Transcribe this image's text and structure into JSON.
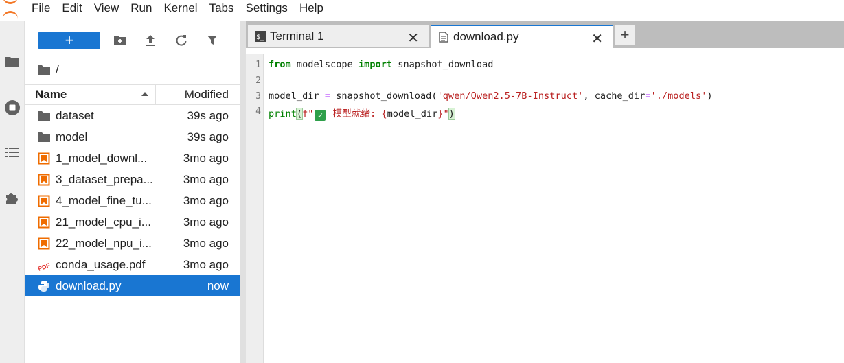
{
  "menubar": {
    "items": [
      "File",
      "Edit",
      "View",
      "Run",
      "Kernel",
      "Tabs",
      "Settings",
      "Help"
    ]
  },
  "toolbar": {
    "new_label": "+"
  },
  "breadcrumb": {
    "path": "/"
  },
  "filelist": {
    "header_name": "Name",
    "header_modified": "Modified",
    "rows": [
      {
        "name": "dataset",
        "modified": "39s ago",
        "icon": "folder-icon"
      },
      {
        "name": "model",
        "modified": "39s ago",
        "icon": "folder-icon"
      },
      {
        "name": "1_model_downl...",
        "modified": "3mo ago",
        "icon": "notebook-icon"
      },
      {
        "name": "3_dataset_prepa...",
        "modified": "3mo ago",
        "icon": "notebook-icon"
      },
      {
        "name": "4_model_fine_tu...",
        "modified": "3mo ago",
        "icon": "notebook-icon"
      },
      {
        "name": "21_model_cpu_i...",
        "modified": "3mo ago",
        "icon": "notebook-icon"
      },
      {
        "name": "22_model_npu_i...",
        "modified": "3mo ago",
        "icon": "notebook-icon"
      },
      {
        "name": "conda_usage.pdf",
        "modified": "3mo ago",
        "icon": "pdf-icon"
      },
      {
        "name": "download.py",
        "modified": "now",
        "icon": "python-icon",
        "selected": true
      }
    ]
  },
  "tabs": [
    {
      "label": "Terminal 1",
      "icon": "terminal-icon",
      "active": false
    },
    {
      "label": "download.py",
      "icon": "file-text-icon",
      "active": true
    }
  ],
  "editor": {
    "line_numbers": [
      "1",
      "2",
      "3",
      "4"
    ],
    "line1": {
      "kw1": "from",
      "mod": " modelscope ",
      "kw2": "import",
      "rest": " snapshot_download"
    },
    "line3": {
      "var": "model_dir ",
      "op": "=",
      "call": " snapshot_download(",
      "str1": "'qwen/Qwen2.5-7B-Instruct'",
      "mid": ", cache_dir",
      "op2": "=",
      "str2": "'./models'",
      "end": ")"
    },
    "line4": {
      "fn": "print",
      "open": "(",
      "fprefix": "f\"",
      "check": "✓",
      "text": " 模型就绪: ",
      "brace_open": "{",
      "var": "model_dir",
      "brace_close": "}",
      "fend": "\"",
      "close": ")"
    }
  },
  "colors": {
    "accent": "#1976d2",
    "jupyter_orange": "#f37726",
    "notebook_orange": "#ef6c00",
    "pdf_red": "#e53935",
    "keyword_green": "#008000",
    "string_red": "#ba2121",
    "operator_purple": "#aa22ff"
  }
}
